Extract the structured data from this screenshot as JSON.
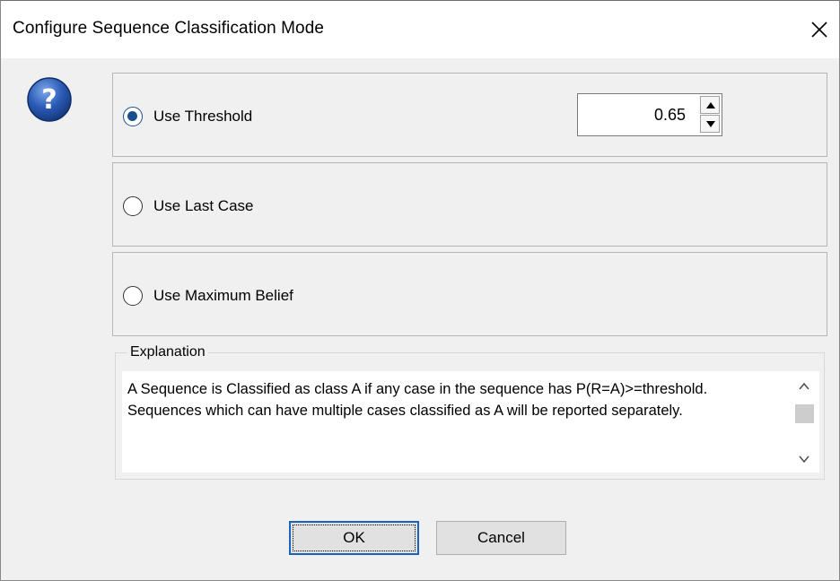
{
  "dialog": {
    "title": "Configure Sequence Classification Mode"
  },
  "options": [
    {
      "label": "Use Threshold",
      "selected": true
    },
    {
      "label": "Use Last Case",
      "selected": false
    },
    {
      "label": "Use Maximum Belief",
      "selected": false
    }
  ],
  "threshold": {
    "value": "0.65"
  },
  "explanation": {
    "label": "Explanation",
    "text": "A Sequence is Classified as class A if any case in the sequence has P(R=A)>=threshold. Sequences which can have multiple cases classified as A will be reported separately."
  },
  "buttons": {
    "ok": "OK",
    "cancel": "Cancel"
  },
  "icons": {
    "help": "question-icon",
    "close": "close-icon"
  },
  "colors": {
    "accent": "#1a4f8f",
    "background": "#f0f0f0",
    "focus_border": "#1c62b9"
  }
}
